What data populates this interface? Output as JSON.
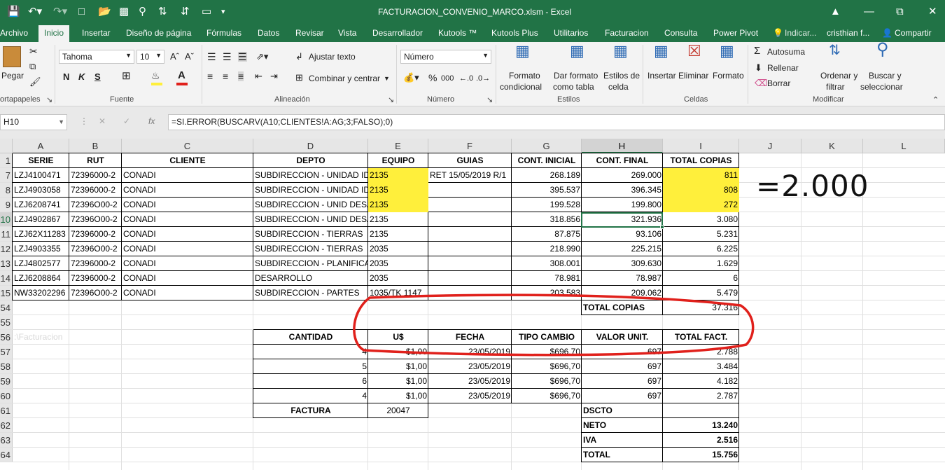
{
  "window": {
    "title": "FACTURACION_CONVENIO_MARCO.xlsm - Excel"
  },
  "ribbon_tabs": [
    "Archivo",
    "Inicio",
    "Insertar",
    "Diseño de página",
    "Fórmulas",
    "Datos",
    "Revisar",
    "Vista",
    "Desarrollador",
    "Kutools ™",
    "Kutools Plus",
    "Utilitarios",
    "Facturacion",
    "Consulta",
    "Power Pivot"
  ],
  "tell_me": "Indicar...",
  "user": "cristhian f...",
  "share": "Compartir",
  "clipboard": {
    "paste": "Pegar",
    "group": "ortapapeles"
  },
  "font": {
    "name": "Tahoma",
    "size": "10",
    "bold": "N",
    "italic": "K",
    "underline": "S",
    "group": "Fuente"
  },
  "alignment": {
    "wrap": "Ajustar texto",
    "merge": "Combinar y centrar",
    "group": "Alineación"
  },
  "number": {
    "format": "Número",
    "percent": "%",
    "thousands": "000",
    "group": "Número"
  },
  "styles": {
    "conditional1": "Formato",
    "conditional2": "condicional",
    "table1": "Dar formato",
    "table2": "como tabla",
    "cell1": "Estilos de",
    "cell2": "celda",
    "group": "Estilos"
  },
  "cells": {
    "insert": "Insertar",
    "delete": "Eliminar",
    "format": "Formato",
    "group": "Celdas"
  },
  "editing": {
    "autosum": "Autosuma",
    "fill": "Rellenar",
    "clear": "Borrar",
    "sort1": "Ordenar y",
    "sort2": "filtrar",
    "find1": "Buscar y",
    "find2": "seleccionar",
    "group": "Modificar"
  },
  "formula_bar": {
    "name_box": "H10",
    "fx": "fx",
    "formula": "=SI.ERROR(BUSCARV(A10;CLIENTES!A:AG;3;FALSO);0)"
  },
  "columns": [
    "A",
    "B",
    "C",
    "D",
    "E",
    "F",
    "G",
    "H",
    "I",
    "J",
    "K",
    "L"
  ],
  "row_numbers": [
    "1",
    "7",
    "8",
    "9",
    "10",
    "11",
    "12",
    "13",
    "14",
    "15",
    "54",
    "55",
    "56",
    "57",
    "58",
    "59",
    "60",
    "61",
    "62",
    "63",
    "64"
  ],
  "headers": [
    "SERIE",
    "RUT",
    "CLIENTE",
    "DEPTO",
    "EQUIPO",
    "GUIAS",
    "CONT. INICIAL",
    "CONT. FINAL",
    "TOTAL COPIAS"
  ],
  "rows": [
    [
      "LZJ4100471",
      "72396000-2",
      "CONADI",
      "SUBDIRECCION - UNIDAD ID",
      "2135",
      "RET 15/05/2019 R/1",
      "268.189",
      "269.000",
      "811"
    ],
    [
      "LZJ4903058",
      "72396000-2",
      "CONADI",
      "SUBDIRECCION - UNIDAD ID",
      "2135",
      "",
      "395.537",
      "396.345",
      "808"
    ],
    [
      "LZJ6208741",
      "72396O00-2",
      "CONADI",
      "SUBDIRECCION - UNID DESA",
      "2135",
      "",
      "199.528",
      "199.800",
      "272"
    ],
    [
      "LZJ4902867",
      "72396O00-2",
      "CONADI",
      "SUBDIRECCION - UNID DESA",
      "2135",
      "",
      "318.856",
      "321.936",
      "3.080"
    ],
    [
      "LZJ62X11283",
      "72396000-2",
      "CONADI",
      "SUBDIRECCION - TIERRAS",
      "2135",
      "",
      "87.875",
      "93.106",
      "5.231"
    ],
    [
      "LZJ4903355",
      "72396O00-2",
      "CONADI",
      "SUBDIRECCION - TIERRAS",
      "2035",
      "",
      "218.990",
      "225.215",
      "6.225"
    ],
    [
      "LZJ4802577",
      "72396000-2",
      "CONADI",
      "SUBDIRECCION - PLANIFICA",
      "2035",
      "",
      "308.001",
      "309.630",
      "1.629"
    ],
    [
      "LZJ6208864",
      "72396000-2",
      "CONADI",
      "DESARROLLO",
      "2035",
      "",
      "78.981",
      "78.987",
      "6"
    ],
    [
      "NW33202296",
      "72396O00-2",
      "CONADI",
      "SUBDIRECCION - PARTES",
      "1035/TK 1147",
      "",
      "203.583",
      "209.062",
      "5.479"
    ]
  ],
  "total_copias": {
    "label": "TOTAL COPIAS",
    "value": "37.316"
  },
  "ghost_text": ":\\Facturacion",
  "invoice": {
    "headers": [
      "CANTIDAD",
      "U$",
      "FECHA",
      "TIPO CAMBIO",
      "VALOR UNIT.",
      "TOTAL FACT."
    ],
    "rows": [
      [
        "4",
        "$1,00",
        "23/05/2019",
        "$696,70",
        "697",
        "2.788"
      ],
      [
        "5",
        "$1,00",
        "23/05/2019",
        "$696,70",
        "697",
        "3.484"
      ],
      [
        "6",
        "$1,00",
        "23/05/2019",
        "$696,70",
        "697",
        "4.182"
      ],
      [
        "4",
        "$1,00",
        "23/05/2019",
        "$696,70",
        "697",
        "2.787"
      ]
    ],
    "factura_label": "FACTURA",
    "factura_value": "20047",
    "summary": [
      [
        "DSCTO",
        ""
      ],
      [
        "NETO",
        "13.240"
      ],
      [
        "IVA",
        "2.516"
      ],
      [
        "TOTAL",
        "15.756"
      ]
    ]
  },
  "annotation": {
    "text": "=2.000",
    "color": "#e0201b"
  }
}
